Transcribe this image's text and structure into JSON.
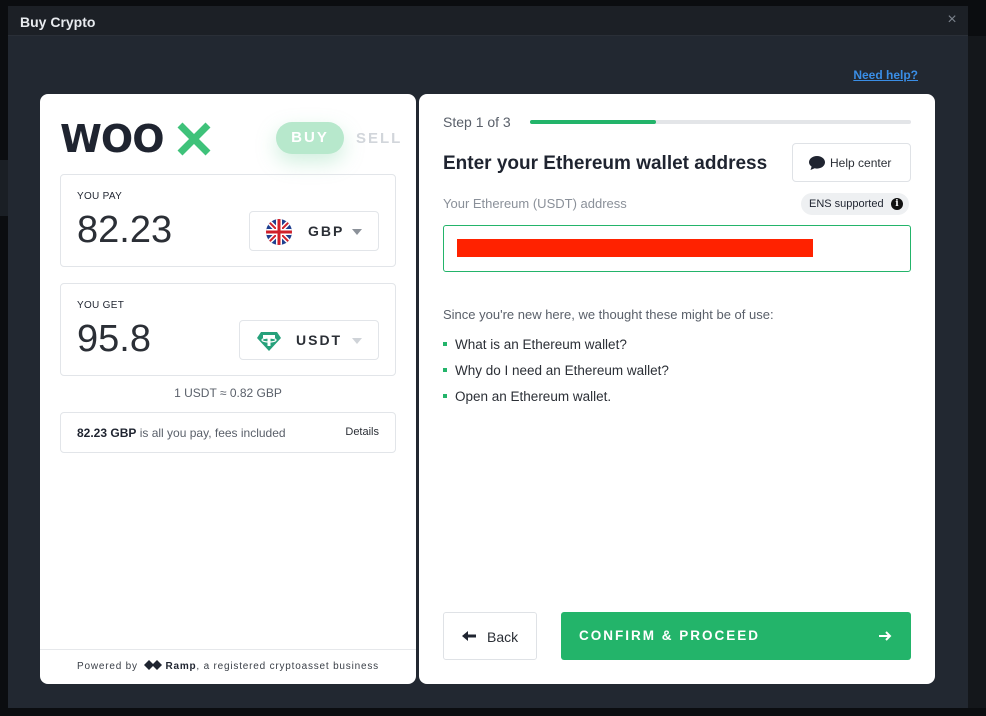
{
  "window": {
    "title": "Buy Crypto",
    "close_glyph": "×"
  },
  "need_help": "Need help?",
  "colors": {
    "brand_green": "#23b46a",
    "buy_tab": "#b7e8cc",
    "link_blue": "#3a8ee6",
    "redaction": "#ff2200"
  },
  "left": {
    "logo_alt": "WOOX",
    "tabs": {
      "buy": "BUY",
      "sell": "SELL"
    },
    "pay": {
      "label": "YOU PAY",
      "value": "82.23",
      "currency": "GBP",
      "icon": "uk-flag-icon"
    },
    "get": {
      "label": "YOU GET",
      "value": "95.8",
      "currency": "USDT",
      "icon": "tether-icon"
    },
    "rate": "1 USDT ≈ 0.82 GBP",
    "fee": {
      "amount": "82.23 GBP",
      "text": " is all you pay, fees included",
      "details": "Details"
    },
    "powered": {
      "prefix": "Powered by",
      "brand": "Ramp",
      "suffix": ", a registered cryptoasset business"
    }
  },
  "right": {
    "step": {
      "label": "Step 1 of 3",
      "progress": 0.33
    },
    "heading": "Enter your Ethereum wallet address",
    "help_center": "Help center",
    "address_label": "Your Ethereum (USDT) address",
    "ens": "ENS supported",
    "info_glyph": "i",
    "hint": "Since you're new here, we thought these might be of use:",
    "links": [
      "What is an Ethereum wallet?",
      "Why do I need an Ethereum wallet?",
      "Open an Ethereum wallet."
    ],
    "back": "Back",
    "confirm": "CONFIRM & PROCEED"
  }
}
